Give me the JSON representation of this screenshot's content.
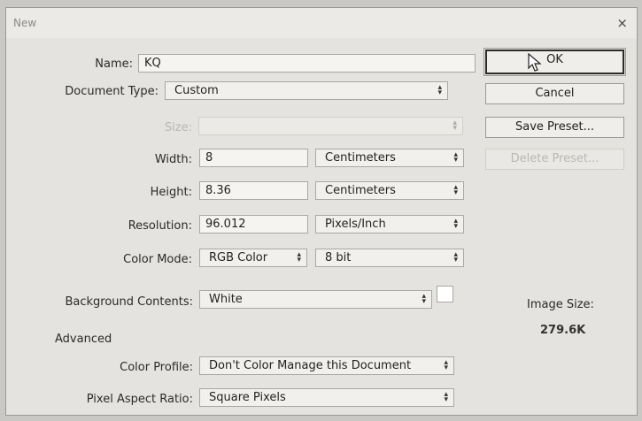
{
  "dialog": {
    "title": "New",
    "close_glyph": "×"
  },
  "form": {
    "name": {
      "label": "Name:",
      "value": "KQ"
    },
    "document_type": {
      "label": "Document Type:",
      "value": "Custom"
    },
    "size": {
      "label": "Size:",
      "value": ""
    },
    "width": {
      "label": "Width:",
      "value": "8",
      "unit": "Centimeters"
    },
    "height": {
      "label": "Height:",
      "value": "8.36",
      "unit": "Centimeters"
    },
    "resolution": {
      "label": "Resolution:",
      "value": "96.012",
      "unit": "Pixels/Inch"
    },
    "color_mode": {
      "label": "Color Mode:",
      "value": "RGB Color",
      "depth": "8 bit"
    },
    "background": {
      "label": "Background Contents:",
      "value": "White",
      "swatch_color": "#ffffff"
    },
    "advanced": {
      "label": "Advanced"
    },
    "color_profile": {
      "label": "Color Profile:",
      "value": "Don't Color Manage this Document"
    },
    "pixel_aspect": {
      "label": "Pixel Aspect Ratio:",
      "value": "Square Pixels"
    }
  },
  "buttons": {
    "ok": "OK",
    "cancel": "Cancel",
    "save_preset": "Save Preset...",
    "delete_preset": "Delete Preset..."
  },
  "image_size": {
    "label": "Image Size:",
    "value": "279.6K"
  }
}
